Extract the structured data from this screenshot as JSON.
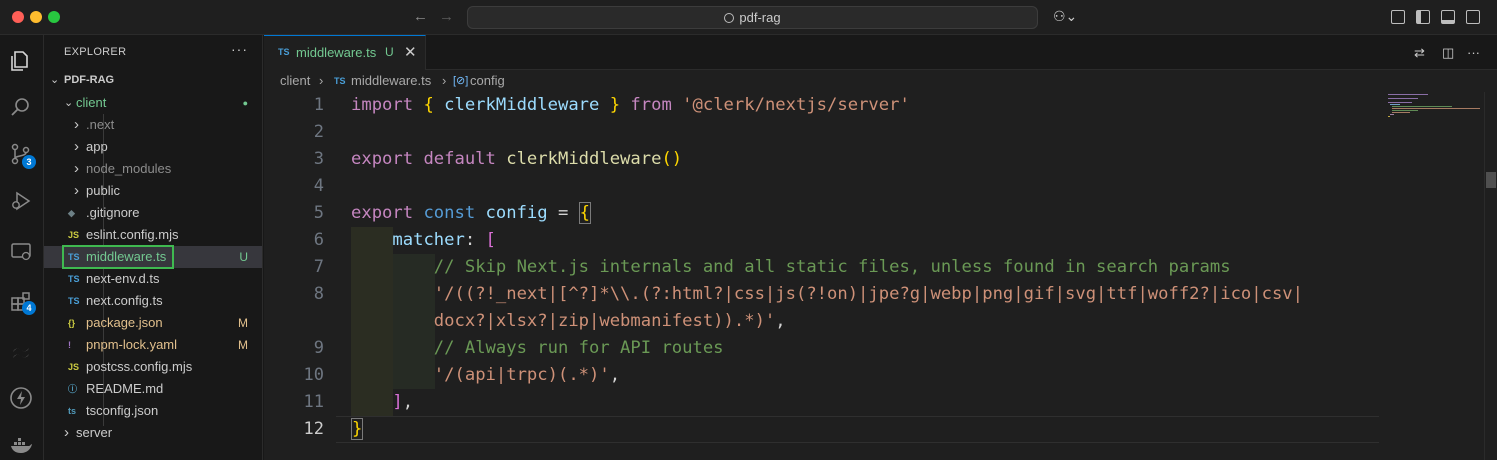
{
  "window": {
    "title": "pdf-rag"
  },
  "colors": {
    "accent": "#0078d4",
    "untracked": "#73c991",
    "modified": "#e2c08d",
    "highlight_box": "#3fb950"
  },
  "activity_bar": {
    "items": [
      {
        "name": "explorer-icon"
      },
      {
        "name": "search-icon"
      },
      {
        "name": "source-control-icon",
        "badge": "3"
      },
      {
        "name": "run-debug-icon"
      },
      {
        "name": "remote-explorer-icon"
      },
      {
        "name": "extensions-icon",
        "badge": "4"
      },
      {
        "name": "tailwind-icon"
      },
      {
        "name": "lightning-icon"
      },
      {
        "name": "docker-icon"
      }
    ]
  },
  "sidebar": {
    "title": "EXPLORER",
    "more": "···",
    "root": "PDF-RAG",
    "tree": [
      {
        "label": "client",
        "type": "folder-open",
        "depth": 1,
        "status": "●",
        "color": "#73c991"
      },
      {
        "label": ".next",
        "type": "folder",
        "depth": 2,
        "color": "#8c8c8c"
      },
      {
        "label": "app",
        "type": "folder",
        "depth": 2,
        "color": "#cccccc"
      },
      {
        "label": "node_modules",
        "type": "folder",
        "depth": 2,
        "color": "#8c8c8c"
      },
      {
        "label": "public",
        "type": "folder",
        "depth": 2,
        "color": "#cccccc"
      },
      {
        "label": ".gitignore",
        "type": "file",
        "icon": "◆",
        "icon_color": "#6d8086",
        "depth": 2,
        "color": "#cccccc"
      },
      {
        "label": "eslint.config.mjs",
        "type": "file",
        "icon": "JS",
        "icon_color": "#cbcb41",
        "depth": 2,
        "color": "#cccccc"
      },
      {
        "label": "middleware.ts",
        "type": "file",
        "icon": "TS",
        "icon_color": "#4a9fd8",
        "depth": 2,
        "status": "U",
        "color": "#73c991",
        "selected": true
      },
      {
        "label": "next-env.d.ts",
        "type": "file",
        "icon": "TS",
        "icon_color": "#4a9fd8",
        "depth": 2,
        "color": "#cccccc"
      },
      {
        "label": "next.config.ts",
        "type": "file",
        "icon": "TS",
        "icon_color": "#4a9fd8",
        "depth": 2,
        "color": "#cccccc"
      },
      {
        "label": "package.json",
        "type": "file",
        "icon": "{}",
        "icon_color": "#cbcb41",
        "depth": 2,
        "status": "M",
        "color": "#e2c08d"
      },
      {
        "label": "pnpm-lock.yaml",
        "type": "file",
        "icon": "!",
        "icon_color": "#a074c4",
        "depth": 2,
        "status": "M",
        "color": "#e2c08d"
      },
      {
        "label": "postcss.config.mjs",
        "type": "file",
        "icon": "JS",
        "icon_color": "#cbcb41",
        "depth": 2,
        "color": "#cccccc"
      },
      {
        "label": "README.md",
        "type": "file",
        "icon": "ⓘ",
        "icon_color": "#519aba",
        "depth": 2,
        "color": "#cccccc"
      },
      {
        "label": "tsconfig.json",
        "type": "file",
        "icon": "ts",
        "icon_color": "#519aba",
        "depth": 2,
        "color": "#cccccc"
      },
      {
        "label": "server",
        "type": "folder",
        "depth": 1,
        "color": "#cccccc"
      }
    ]
  },
  "tab": {
    "icon": "TS",
    "name": "middleware.ts",
    "status": "U",
    "close": "✕"
  },
  "breadcrumb": {
    "folder": "client",
    "sep": "›",
    "file_icon": "TS",
    "file": "middleware.ts",
    "symbol_icon": "[⊘]",
    "symbol": "config"
  },
  "code": {
    "lines": [
      {
        "n": "1",
        "tokens": [
          [
            "kw-purple",
            "import "
          ],
          [
            "brace",
            "{ "
          ],
          [
            "var",
            "clerkMiddleware"
          ],
          [
            "brace",
            " }"
          ],
          [
            "kw-purple",
            " from "
          ],
          [
            "str",
            "'@clerk/nextjs/server'"
          ]
        ]
      },
      {
        "n": "2",
        "tokens": []
      },
      {
        "n": "3",
        "tokens": [
          [
            "kw-purple",
            "export "
          ],
          [
            "kw-purple",
            "default "
          ],
          [
            "fn",
            "clerkMiddleware"
          ],
          [
            "brace",
            "()"
          ]
        ]
      },
      {
        "n": "4",
        "tokens": []
      },
      {
        "n": "5",
        "tokens": [
          [
            "kw-purple",
            "export "
          ],
          [
            "kw-blue",
            "const "
          ],
          [
            "var",
            "config "
          ],
          [
            "plain",
            "= "
          ],
          [
            "brace",
            "{"
          ]
        ]
      },
      {
        "n": "6",
        "tokens": [
          [
            "plain",
            "    "
          ],
          [
            "var",
            "matcher"
          ],
          [
            "plain",
            ": "
          ],
          [
            "brace2",
            "["
          ]
        ]
      },
      {
        "n": "7",
        "tokens": [
          [
            "plain",
            "        "
          ],
          [
            "cmt",
            "// Skip Next.js internals and all static files, unless found in search params"
          ]
        ]
      },
      {
        "n": "8",
        "tokens": [
          [
            "plain",
            "        "
          ],
          [
            "str",
            "'/((?!_next|[^?]*\\\\.(?:html?|css|js(?!on)|jpe?g|webp|png|gif|svg|ttf|woff2?|ico|csv|"
          ]
        ]
      },
      {
        "n": "",
        "tokens": [
          [
            "plain",
            "        "
          ],
          [
            "str",
            "docx?|xlsx?|zip|webmanifest)).*)'"
          ],
          [
            "plain",
            ","
          ]
        ]
      },
      {
        "n": "9",
        "tokens": [
          [
            "plain",
            "        "
          ],
          [
            "cmt",
            "// Always run for API routes"
          ]
        ]
      },
      {
        "n": "10",
        "tokens": [
          [
            "plain",
            "        "
          ],
          [
            "str",
            "'/(api|trpc)(.*)'"
          ],
          [
            "plain",
            ","
          ]
        ]
      },
      {
        "n": "11",
        "tokens": [
          [
            "plain",
            "    "
          ],
          [
            "brace2",
            "]"
          ],
          [
            "plain",
            ","
          ]
        ]
      },
      {
        "n": "12",
        "tokens": [
          [
            "brace",
            "}"
          ]
        ],
        "active": true
      }
    ]
  }
}
